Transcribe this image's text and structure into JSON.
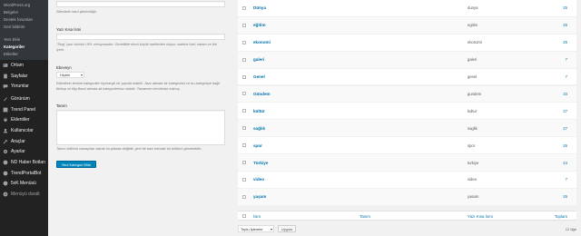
{
  "sidebar": {
    "sub_top": [
      "WordPress.org",
      "Belgeler",
      "Destek forumları",
      "Geri bildirim"
    ],
    "sub_posts": [
      "Yeni Ekle",
      "Kategoriler",
      "Etiketler"
    ],
    "menu": [
      {
        "label": "Ortam",
        "icon": "media-icon"
      },
      {
        "label": "Sayfalar",
        "icon": "pages-icon"
      },
      {
        "label": "Yorumlar",
        "icon": "comments-icon"
      },
      {
        "label": "Görünüm",
        "icon": "appearance-icon"
      },
      {
        "label": "Trend Panel",
        "icon": "trend-panel-icon"
      },
      {
        "label": "Eklentiler",
        "icon": "plugins-icon"
      },
      {
        "label": "Kullanıcılar",
        "icon": "users-icon"
      },
      {
        "label": "Araçlar",
        "icon": "tools-icon"
      },
      {
        "label": "Ayarlar",
        "icon": "settings-icon"
      },
      {
        "label": "ND Haber Botları",
        "icon": "bot-icon"
      },
      {
        "label": "TrendPortalBot",
        "icon": "bot-icon"
      },
      {
        "label": "5xK Menüsü",
        "icon": "menu-icon"
      },
      {
        "label": "Menüyü daralt",
        "icon": "collapse-icon"
      }
    ]
  },
  "form": {
    "name_help": "Sitenizde nasıl göründüğü.",
    "slug_label": "Yazı Kısa İsmi",
    "slug_help": "\"Slug\" yazı isminin URL versiyonudur. Genellikle tümü küçük harflerden oluşur, sadece harf, rakam ve tire içerir.",
    "parent_label": "Ebeveyn",
    "parent_value": "Hiçbiri",
    "parent_help": "Etiketlerin tersine kategoriler hiyerarşik bir yapıda olabilir. Jazz adında bir kategoriniz ve bu kategoriye bağlı Bebop ve Big Band adında alt kategorileriniz olabilir. Tamamen tercihinize kalmış.",
    "desc_label": "Tanım",
    "desc_help": "Tanım bölümü varsayılan olarak ön planda değildir, yine de bazı temalar bu bölümü gösterebilir.",
    "submit_label": "Yeni Kategori Ekle"
  },
  "table": {
    "rows": [
      {
        "name": "Dünya",
        "slug": "dunya",
        "count": "25"
      },
      {
        "name": "eğitim",
        "slug": "egitim",
        "count": "26"
      },
      {
        "name": "ekonomi",
        "slug": "ekonomi",
        "count": "26"
      },
      {
        "name": "galeri",
        "slug": "galeri",
        "count": "7"
      },
      {
        "name": "Genel",
        "slug": "genel",
        "count": "7"
      },
      {
        "name": "Gündem",
        "slug": "gundem",
        "count": "33"
      },
      {
        "name": "kültür",
        "slug": "kultur",
        "count": "27"
      },
      {
        "name": "sağlık",
        "slug": "saglik",
        "count": "27"
      },
      {
        "name": "spor",
        "slug": "spor",
        "count": "26"
      },
      {
        "name": "Türkiye",
        "slug": "turkiye",
        "count": "24"
      },
      {
        "name": "video",
        "slug": "video",
        "count": "7"
      },
      {
        "name": "yaşam",
        "slug": "yasam",
        "count": "26"
      }
    ],
    "footer": {
      "name": "İsim",
      "description": "Tanım",
      "slug": "Yazı Kısa İsmi",
      "count": "Toplam"
    }
  },
  "bulk": {
    "select_value": "Toplu İşlemler",
    "apply_label": "Uygula",
    "item_count": "12 öğe"
  },
  "colors": {
    "accent": "#0073aa",
    "sidebar_bg": "#222222",
    "primary_button": "#0085ba"
  }
}
